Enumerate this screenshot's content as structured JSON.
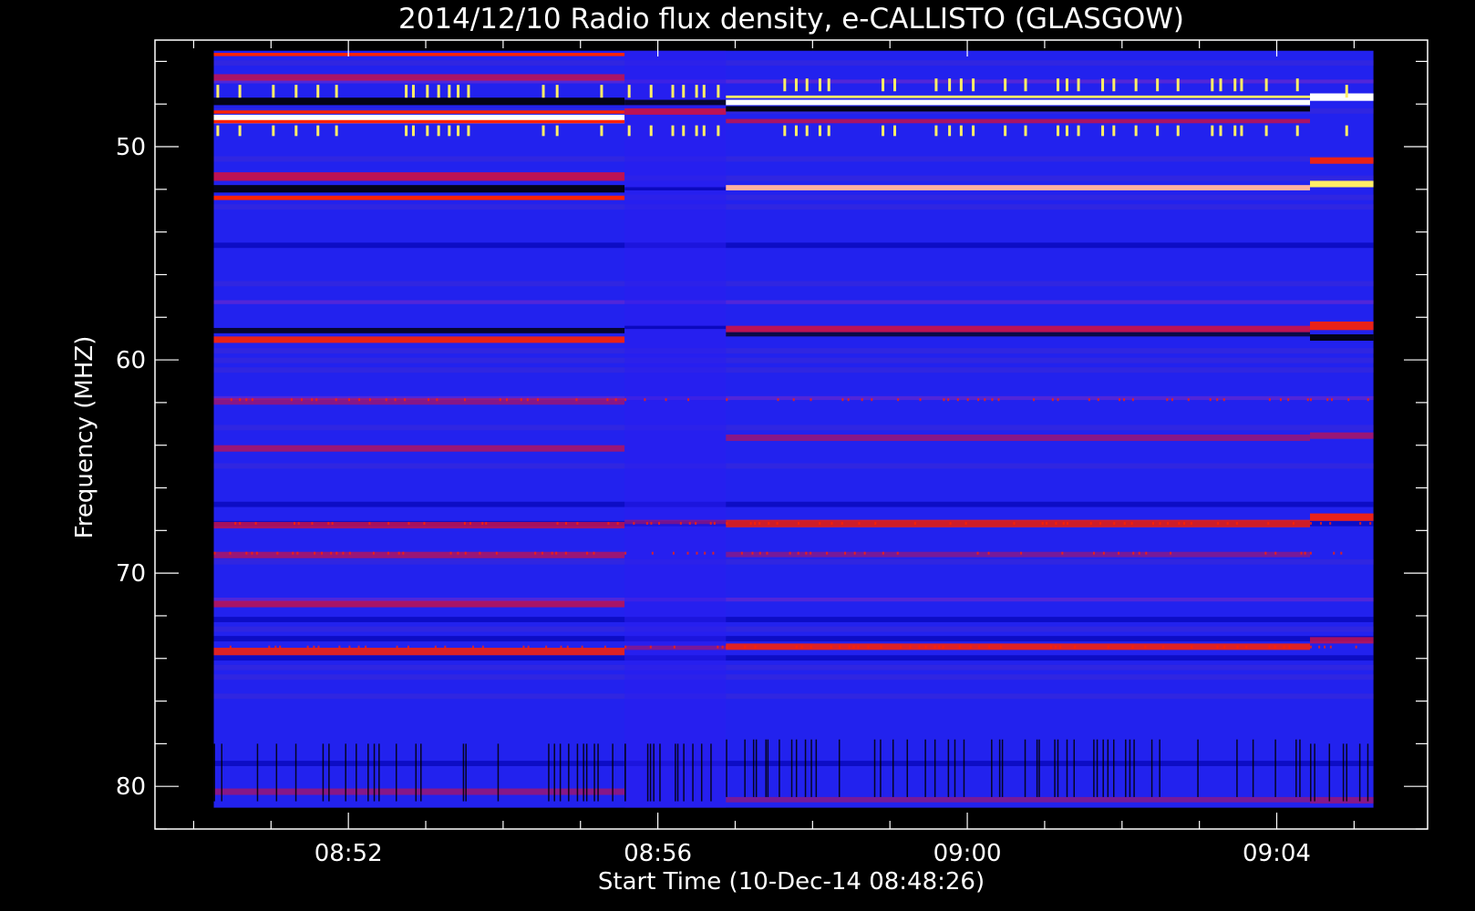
{
  "chart_data": {
    "type": "heatmap",
    "title": "2014/12/10  Radio flux density, e-CALLISTO (GLASGOW)",
    "xlabel": "Start Time (10-Dec-14 08:48:26)",
    "ylabel": "Frequency (MHZ)",
    "x_tick_labels": [
      "08:52",
      "08:56",
      "09:00",
      "09:04"
    ],
    "x_major_ticks_min": [
      8.0,
      12.0,
      16.0,
      20.0
    ],
    "x_minor_step_min": 1,
    "xlim_min_from_0848": [
      5.5,
      21.95
    ],
    "data_extent_min_from_0848": [
      6.26,
      21.25
    ],
    "y_tick_values": [
      50,
      60,
      70,
      80
    ],
    "y_minor_step": 2,
    "ylim": [
      45,
      82
    ],
    "data_extent_freq": [
      45.5,
      81
    ],
    "y_inverted": true,
    "segments_min_from_0848": [
      {
        "t0": 6.26,
        "t1": 11.57
      },
      {
        "t0": 11.57,
        "t1": 12.88
      },
      {
        "t0": 12.88,
        "t1": 20.43
      },
      {
        "t0": 20.43,
        "t1": 21.25
      }
    ],
    "colors": {
      "background": "#000000",
      "axes": "#ffffff",
      "base": "#2222ee",
      "low": "#0000aa",
      "mid": "#cc1144",
      "high": "#ff2200",
      "hot": "#ffee66",
      "max": "#ffffff"
    }
  }
}
